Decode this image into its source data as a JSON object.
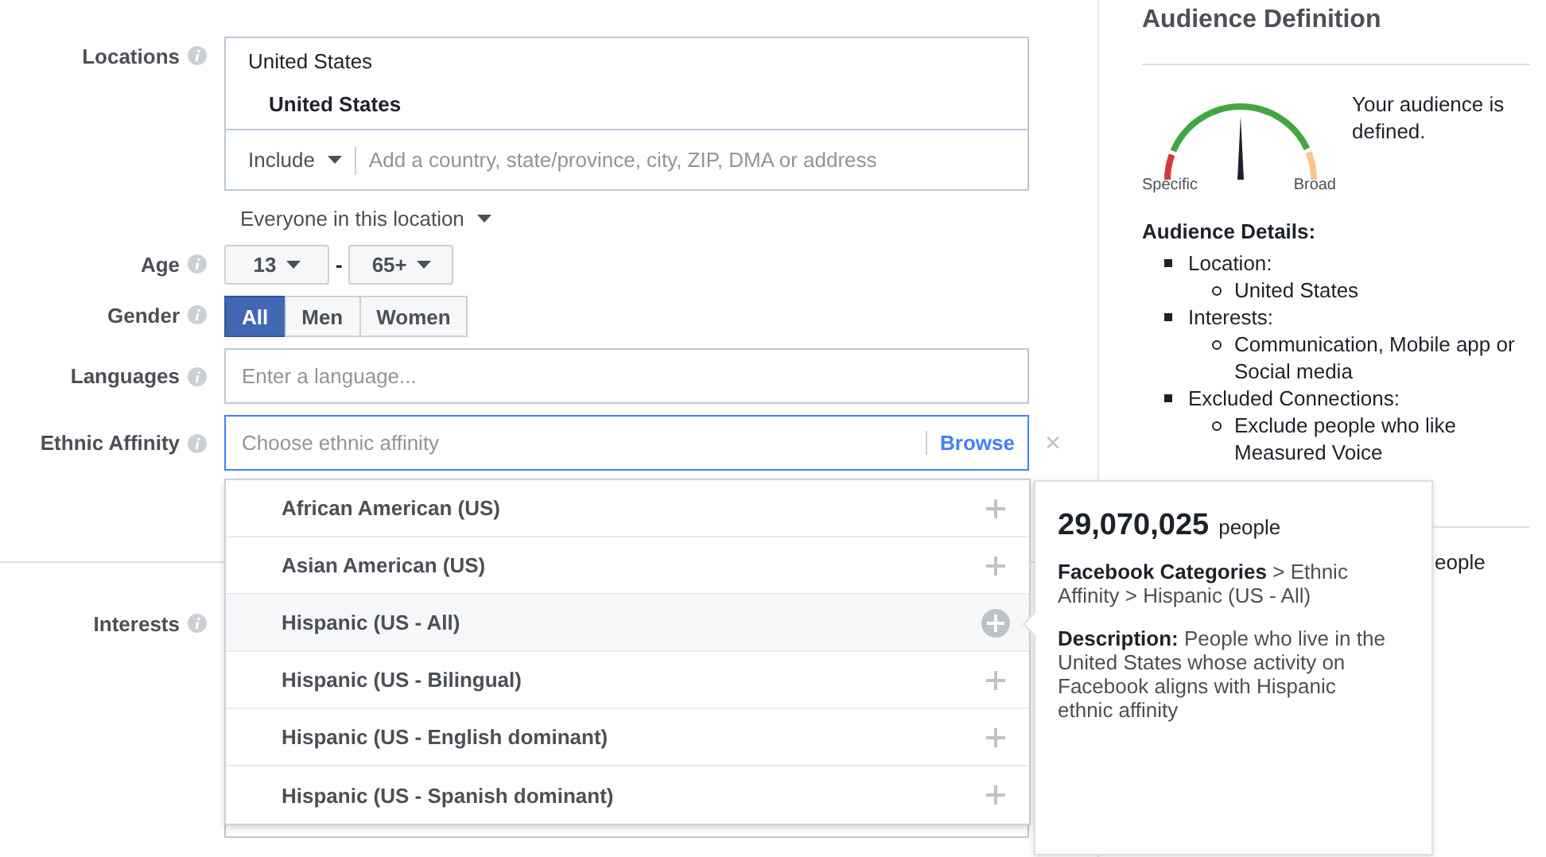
{
  "form": {
    "locations": {
      "label": "Locations",
      "list_title": "United States",
      "selected_location": "United States",
      "include_select": "Include",
      "placeholder": "Add a country, state/province, city, ZIP, DMA or address",
      "audience_select": "Everyone in this location"
    },
    "age": {
      "label": "Age",
      "min": "13",
      "separator": "-",
      "max": "65+"
    },
    "gender": {
      "label": "Gender",
      "options": [
        {
          "label": "All",
          "selected": true
        },
        {
          "label": "Men",
          "selected": false
        },
        {
          "label": "Women",
          "selected": false
        }
      ]
    },
    "languages": {
      "label": "Languages",
      "placeholder": "Enter a language..."
    },
    "ethnic_affinity": {
      "label": "Ethnic Affinity",
      "placeholder": "Choose ethnic affinity",
      "browse": "Browse",
      "remove": "×"
    },
    "interests": {
      "label": "Interests"
    }
  },
  "dropdown": {
    "items": [
      {
        "label": "African American (US)",
        "highlighted": false
      },
      {
        "label": "Asian American (US)",
        "highlighted": false
      },
      {
        "label": "Hispanic (US - All)",
        "highlighted": true
      },
      {
        "label": "Hispanic (US - Bilingual)",
        "highlighted": false
      },
      {
        "label": "Hispanic (US - English dominant)",
        "highlighted": false
      },
      {
        "label": "Hispanic (US - Spanish dominant)",
        "highlighted": false
      }
    ]
  },
  "tooltip": {
    "reach": "29,070,025",
    "unit": "people",
    "path": "**Facebook Categories** > Ethnic Affinity > Hispanic (US - All)",
    "description": "**Description:** People who live in the United States whose activity on Facebook aligns with Hispanic ethnic affinity"
  },
  "audience": {
    "title": "Audience Definition",
    "gauge": {
      "low_label": "Specific",
      "high_label": "Broad",
      "level": 0.5
    },
    "status": "Your audience is defined.",
    "details_title": "Audience Details:",
    "details": [
      {
        "label": "Location:",
        "children": [
          {
            "label": "United States"
          }
        ]
      },
      {
        "label": "Interests:",
        "children": [
          {
            "label": "Communication, Mobile app or Social media"
          }
        ]
      },
      {
        "label": "Excluded Connections:",
        "children": [
          {
            "label": "Exclude people who like Measured Voice"
          }
        ]
      }
    ],
    "reach_fragment": "eople"
  }
}
